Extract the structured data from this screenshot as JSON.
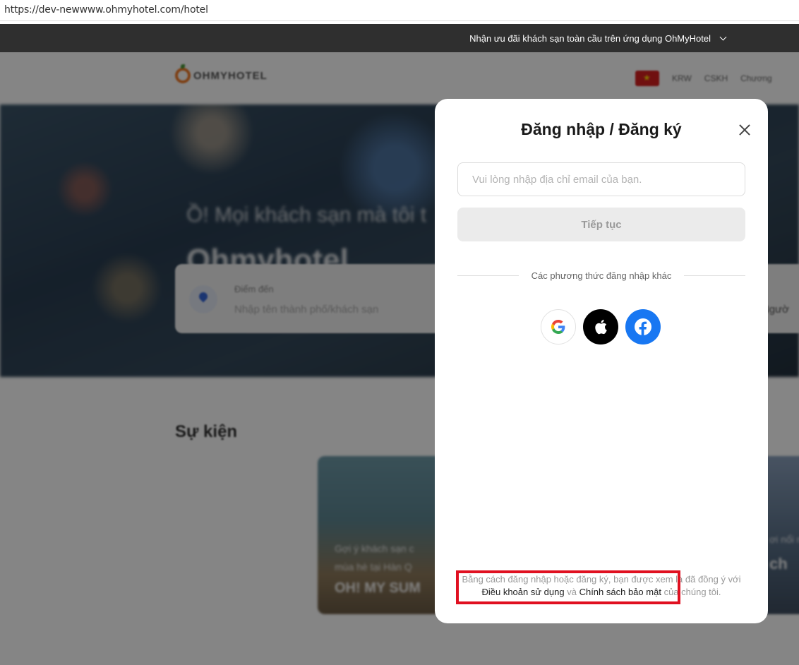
{
  "browser": {
    "url": "https://dev-newwww.ohmyhotel.com/hotel"
  },
  "promo_bar": {
    "text": "Nhận ưu đãi khách sạn toàn cầu trên ứng dụng OhMyHotel"
  },
  "header": {
    "logo_text": "OHMYHOTEL",
    "currency": "KRW",
    "links": [
      "CSKH",
      "Chương"
    ]
  },
  "hero": {
    "headline": "Ồ! Mọi khách sạn mà tôi t",
    "brand": "Ohmyhotel",
    "search": {
      "destination_label": "Điểm đến",
      "destination_placeholder": "Nhập tên thành phố/khách sạn",
      "guests_partial": "Ngườ"
    }
  },
  "events": {
    "title": "Sự kiện",
    "cards": [
      {
        "line1": "Gợi ý khách sạn c",
        "line2": "mùa hè tại Hàn Q",
        "headline": "OH! MY SUM"
      },
      {
        "line1": "ơi nổi n",
        "headline": "ch"
      }
    ]
  },
  "login_modal": {
    "title": "Đăng nhập / Đăng ký",
    "email_placeholder": "Vui lòng nhập địa chỉ email của bạn.",
    "continue_label": "Tiếp tục",
    "other_methods": "Các phương thức đăng nhập khác",
    "social_buttons": [
      {
        "name": "google",
        "icon": "google-icon",
        "color": "#ffffff"
      },
      {
        "name": "apple",
        "icon": "apple-icon",
        "color": "#000000"
      },
      {
        "name": "facebook",
        "icon": "facebook-icon",
        "color": "#1877f2"
      }
    ],
    "terms": {
      "prefix": "Bằng cách đăng nhập hoặc đăng ký, bạn được xem là đã đồng ý với",
      "terms_link": "Điều khoản sử dụng",
      "and": "và",
      "privacy_link": "Chính sách bảo mật",
      "suffix": "của chúng tôi."
    }
  },
  "annotation": {
    "highlight_color": "#e01020"
  }
}
